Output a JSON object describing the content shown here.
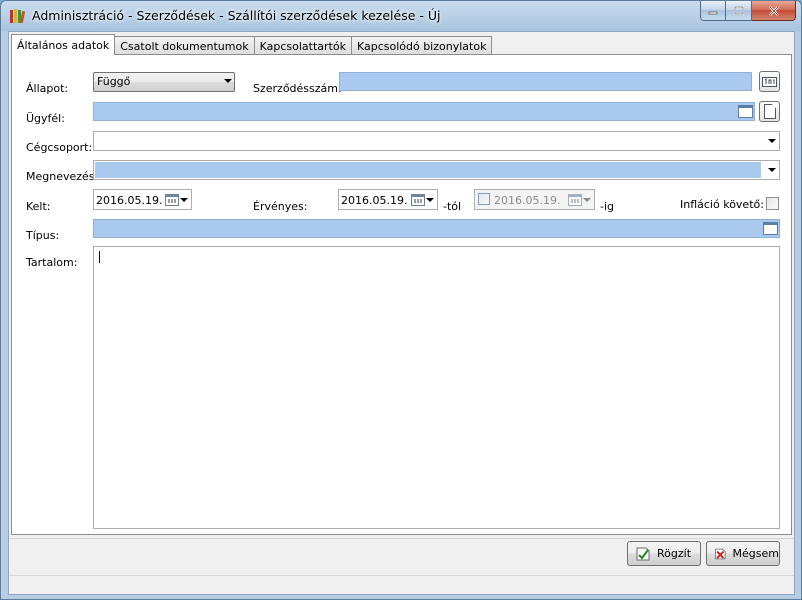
{
  "window": {
    "title": "Adminisztráció - Szerződések - Szállítói szerződések kezelése - Új"
  },
  "tabs": [
    {
      "label": "Általános adatok",
      "active": true
    },
    {
      "label": "Csatolt dokumentumok",
      "active": false
    },
    {
      "label": "Kapcsolattartók",
      "active": false
    },
    {
      "label": "Kapcsolódó bizonylatok",
      "active": false
    }
  ],
  "form": {
    "allapot": {
      "label": "Állapot:",
      "value": "Függő"
    },
    "szerzodesszam": {
      "label": "Szerződésszám:",
      "value": ""
    },
    "ugyfel": {
      "label": "Ügyfél:",
      "value": ""
    },
    "cegcsoport": {
      "label": "Cégcsoport:",
      "value": ""
    },
    "megnevezes": {
      "label": "Megnevezés:",
      "value": ""
    },
    "kelt": {
      "label": "Kelt:",
      "value": "2016.05.19."
    },
    "ervenyes": {
      "label": "Érvényes:",
      "from_value": "2016.05.19.",
      "from_suffix": "-tól",
      "to_value": "2016.05.19.",
      "to_suffix": "-ig"
    },
    "inflacio": {
      "label": "Infláció követő:",
      "checked": false
    },
    "tipus": {
      "label": "Típus:",
      "value": ""
    },
    "tartalom": {
      "label": "Tartalom:",
      "value": ""
    }
  },
  "buttons": {
    "save": "Rögzít",
    "cancel": "Mégsem"
  },
  "colors": {
    "required_field": "#a9c9ee",
    "close_button": "#c24a33"
  }
}
